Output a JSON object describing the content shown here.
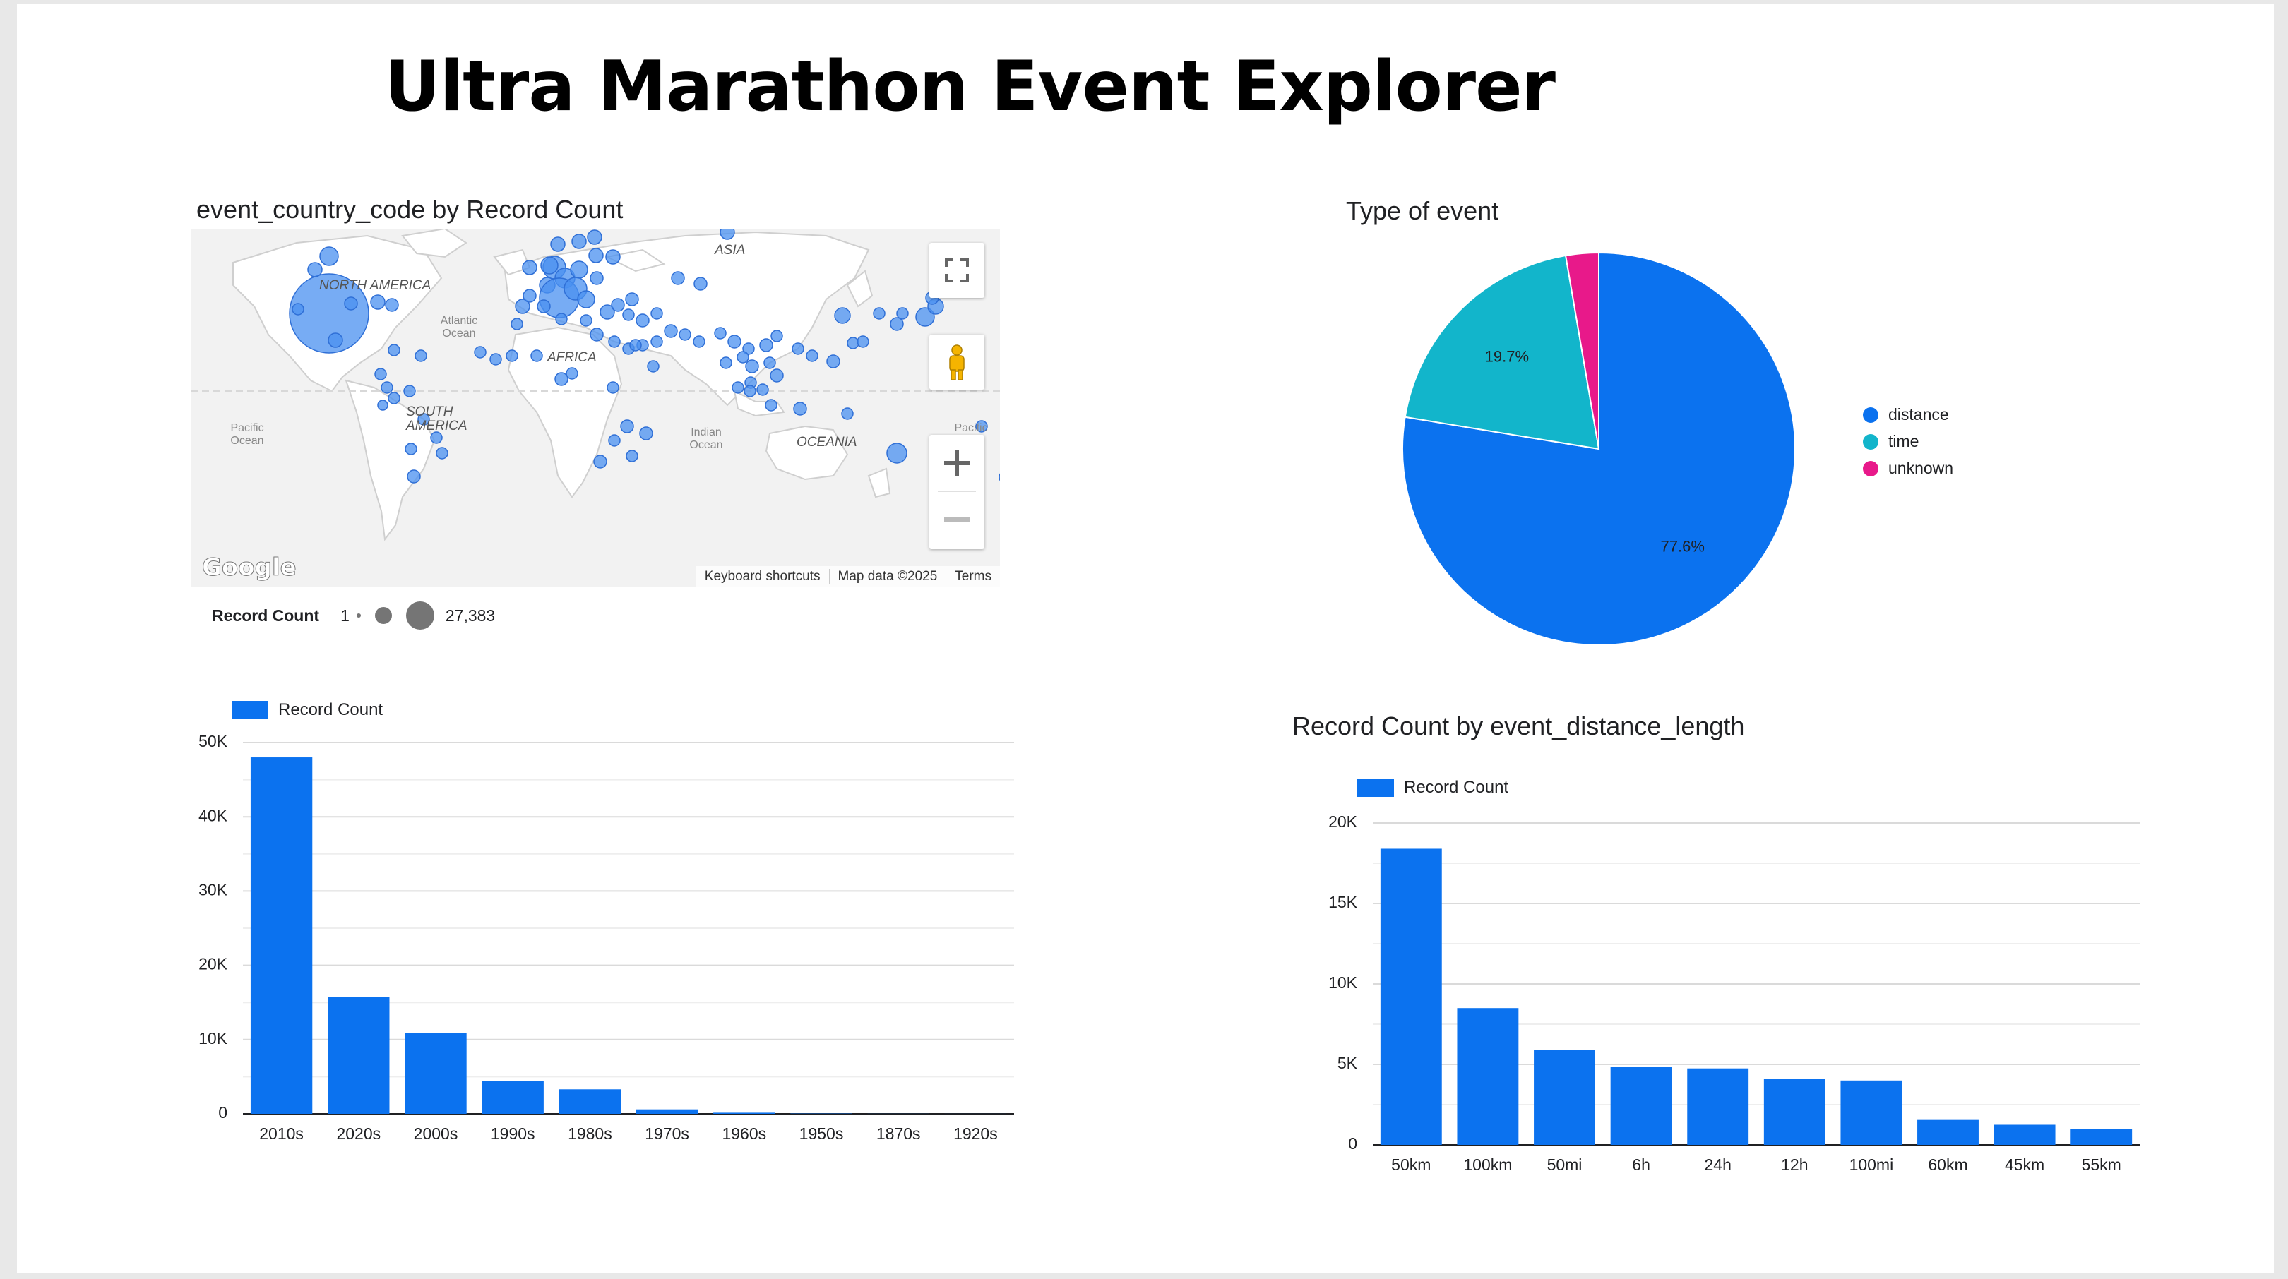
{
  "title": "Ultra Marathon Event Explorer",
  "colors": {
    "bar": "#0b72ef",
    "distance": "#0b72ef",
    "time": "#12b5cb",
    "unknown": "#e8198a",
    "map_bubble": "#4a90f0"
  },
  "map": {
    "title": "event_country_code by Record Count",
    "labels": {
      "north_america": "NORTH AMERICA",
      "south_america": "SOUTH AMERICA",
      "africa": "AFRICA",
      "asia": "ASIA",
      "oceania": "OCEANIA"
    },
    "oceans": {
      "atlantic": "Atlantic Ocean",
      "indian": "Indian Ocean",
      "pacific_left": "Pacific Ocean",
      "pacific_right": "Pacific"
    },
    "footer": {
      "shortcuts": "Keyboard shortcuts",
      "map_data": "Map data ©2025",
      "terms": "Terms"
    },
    "google": "Google",
    "icons": {
      "fullscreen": "fullscreen-icon",
      "pegman": "pegman-icon",
      "zoom_in": "plus-icon",
      "zoom_out": "minus-icon"
    },
    "size_legend": {
      "label": "Record Count",
      "min": "1",
      "max": "27,383"
    }
  },
  "pie": {
    "title": "Type of event",
    "legend": [
      "distance",
      "time",
      "unknown"
    ]
  },
  "bar_decade": {
    "legend": "Record Count"
  },
  "bar_distance": {
    "title": "Record Count by event_distance_length",
    "legend": "Record Count"
  },
  "chart_data": [
    {
      "type": "pie",
      "title": "Type of event",
      "slices": [
        {
          "label": "distance",
          "value": 77.6,
          "display": "77.6%"
        },
        {
          "label": "time",
          "value": 19.7,
          "display": "19.7%"
        },
        {
          "label": "unknown",
          "value": 2.7,
          "display": ""
        }
      ]
    },
    {
      "type": "bar",
      "title": "",
      "categories": [
        "2010s",
        "2020s",
        "2000s",
        "1990s",
        "1980s",
        "1970s",
        "1960s",
        "1950s",
        "1870s",
        "1920s"
      ],
      "series": [
        {
          "name": "Record Count",
          "values": [
            48000,
            15700,
            10900,
            4400,
            3300,
            600,
            150,
            40,
            10,
            5
          ]
        }
      ],
      "ylim": [
        0,
        50000
      ],
      "yticks": [
        {
          "v": 0,
          "label": "0"
        },
        {
          "v": 10000,
          "label": "10K"
        },
        {
          "v": 20000,
          "label": "20K"
        },
        {
          "v": 30000,
          "label": "30K"
        },
        {
          "v": 40000,
          "label": "40K"
        },
        {
          "v": 50000,
          "label": "50K"
        }
      ],
      "minor_gridlines": true
    },
    {
      "type": "bar",
      "title": "Record Count by event_distance_length",
      "categories": [
        "50km",
        "100km",
        "50mi",
        "6h",
        "24h",
        "12h",
        "100mi",
        "60km",
        "45km",
        "55km"
      ],
      "series": [
        {
          "name": "Record Count",
          "values": [
            18400,
            8500,
            5900,
            4850,
            4750,
            4100,
            4000,
            1550,
            1250,
            1000
          ]
        }
      ],
      "ylim": [
        0,
        20000
      ],
      "yticks": [
        {
          "v": 0,
          "label": "0"
        },
        {
          "v": 5000,
          "label": "5K"
        },
        {
          "v": 10000,
          "label": "10K"
        },
        {
          "v": 15000,
          "label": "15K"
        },
        {
          "v": 20000,
          "label": "20K"
        }
      ],
      "minor_gridlines": true
    }
  ]
}
